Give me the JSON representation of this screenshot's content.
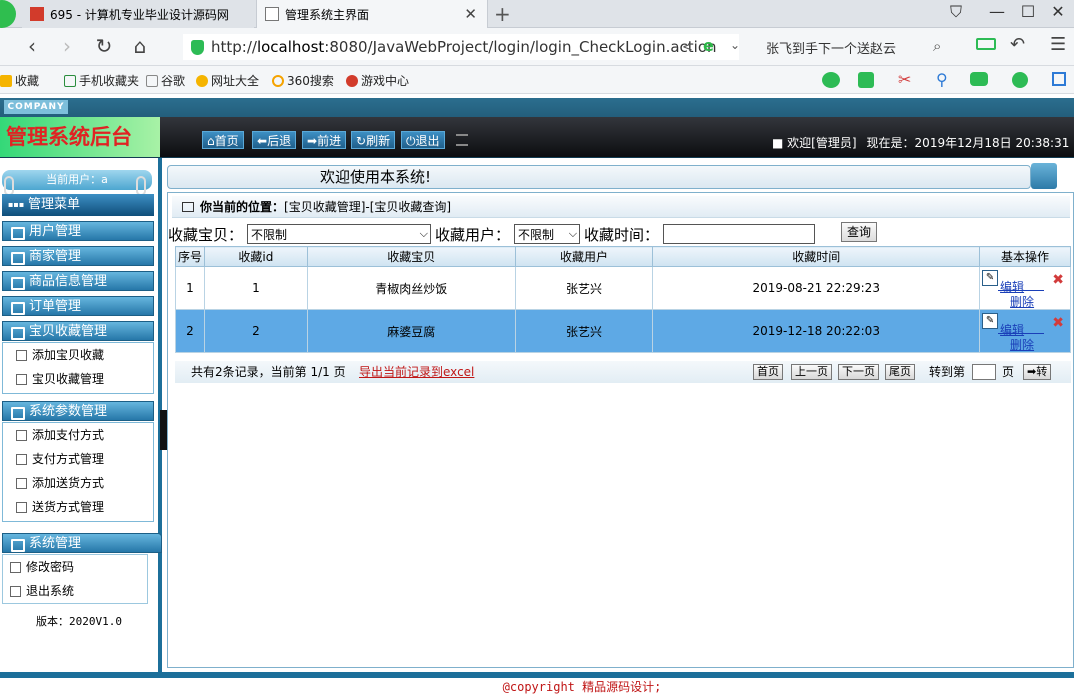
{
  "browser": {
    "tabs": [
      {
        "label": "695 - 计算机专业毕业设计源码网"
      },
      {
        "label": "管理系统主界面"
      }
    ],
    "address": {
      "scheme": "http://",
      "host": "localhost",
      "rest": ":8080/JavaWebProject/login/login_CheckLogin.action"
    },
    "search_text": "张飞到手下一个送赵云",
    "bookmarks": [
      "收藏",
      "手机收藏夹",
      "谷歌",
      "网址大全",
      "360搜索",
      "游戏中心"
    ]
  },
  "header": {
    "company": "COMPANY",
    "title": "管理系统后台",
    "toolbar": [
      "首页",
      "后退",
      "前进",
      "刷新",
      "退出"
    ],
    "welcome": "欢迎[管理员]",
    "time_label": "现在是：",
    "time_value": "2019年12月18日 20:38:31"
  },
  "sidebar": {
    "current_user": "当前用户：a",
    "menu_title": "管理菜单",
    "sections": [
      "用户管理",
      "商家管理",
      "商品信息管理",
      "订单管理",
      "宝贝收藏管理"
    ],
    "favorites_items": [
      "添加宝贝收藏",
      "宝贝收藏管理"
    ],
    "sys_param_title": "系统参数管理",
    "sys_param_items": [
      "添加支付方式",
      "支付方式管理",
      "添加送货方式",
      "送货方式管理"
    ],
    "sys_title": "系统管理",
    "sys_items": [
      "修改密码",
      "退出系统"
    ],
    "version": "版本：2020V1.0"
  },
  "main": {
    "welcome_banner": "欢迎使用本系统!",
    "location_label": "你当前的位置：",
    "location_path": "[宝贝收藏管理]-[宝贝收藏查询]",
    "filters": {
      "item_label": "收藏宝贝：",
      "item_value": "不限制",
      "user_label": "收藏用户：",
      "user_value": "不限制",
      "time_label": "收藏时间：",
      "time_value": "",
      "query_button": "查询"
    },
    "table": {
      "headers": [
        "序号",
        "收藏id",
        "收藏宝贝",
        "收藏用户",
        "收藏时间",
        "基本操作"
      ],
      "rows": [
        {
          "no": "1",
          "id": "1",
          "item": "青椒肉丝炒饭",
          "user": "张艺兴",
          "time": "2019-08-21 22:29:23"
        },
        {
          "no": "2",
          "id": "2",
          "item": "麻婆豆腐",
          "user": "张艺兴",
          "time": "2019-12-18 20:22:03"
        }
      ],
      "edit_label": "编辑",
      "delete_label": "删除"
    },
    "pager": {
      "record_count": "共有2条记录，当前第 1/1 页",
      "export": "导出当前记录到excel",
      "buttons": [
        "首页",
        "上一页",
        "下一页",
        "尾页"
      ],
      "goto_label": "转到第",
      "page_unit": "页",
      "go_button": "➡转"
    }
  },
  "footer": {
    "copyright": "@copyright 精品源码设计;"
  }
}
